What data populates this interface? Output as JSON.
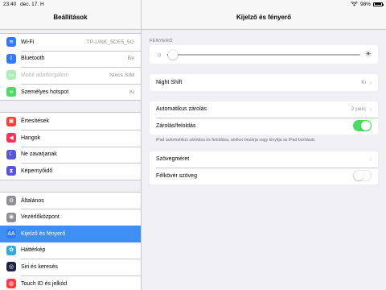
{
  "status_bar": {
    "time": "23:40",
    "date": "dec. 17. H",
    "battery": "98%",
    "battery_level": 0.98
  },
  "sidebar": {
    "title": "Beállítások",
    "groups": [
      [
        {
          "label": "Wi-Fi",
          "value": "TP-LINK_5CE5_5G",
          "icon": "wifi-icon",
          "color": "#3478f6",
          "glyph": "≋"
        },
        {
          "label": "Bluetooth",
          "value": "Be",
          "icon": "bluetooth-icon",
          "color": "#3478f6",
          "glyph": "ᛒ"
        },
        {
          "label": "Mobil adatforgalom",
          "value": "Nincs SIM",
          "icon": "cellular-icon",
          "color": "#4cd964",
          "glyph": "((•))",
          "dim": true
        },
        {
          "label": "Személyes hotspot",
          "value": "Ki",
          "icon": "hotspot-icon",
          "color": "#4cd964",
          "glyph": "∞"
        }
      ],
      [
        {
          "label": "Értesítések",
          "value": "",
          "icon": "notifications-icon",
          "color": "#fc3d39",
          "glyph": "▣"
        },
        {
          "label": "Hangok",
          "value": "",
          "icon": "sounds-icon",
          "color": "#fc3158",
          "glyph": "◀"
        },
        {
          "label": "Ne zavarjanak",
          "value": "",
          "icon": "do-not-disturb-icon",
          "color": "#5856d6",
          "glyph": "☾"
        },
        {
          "label": "Képernyőidő",
          "value": "",
          "icon": "screen-time-icon",
          "color": "#5856d6",
          "glyph": "⧗"
        }
      ],
      [
        {
          "label": "Általános",
          "value": "",
          "icon": "general-icon",
          "color": "#8e8e93",
          "glyph": "⚙"
        },
        {
          "label": "Vezérlőközpont",
          "value": "",
          "icon": "control-center-icon",
          "color": "#8e8e93",
          "glyph": "◉"
        },
        {
          "label": "Kijelző és fényerő",
          "value": "",
          "icon": "display-brightness-icon",
          "color": "#3478f6",
          "glyph": "AA",
          "selected": true
        },
        {
          "label": "Háttérkép",
          "value": "",
          "icon": "wallpaper-icon",
          "color": "#34aadc",
          "glyph": "✿"
        },
        {
          "label": "Siri és keresés",
          "value": "",
          "icon": "siri-icon",
          "color": "#222244",
          "glyph": "◎"
        },
        {
          "label": "Touch ID és jelkód",
          "value": "",
          "icon": "touch-id-icon",
          "color": "#fc3d39",
          "glyph": "◍"
        }
      ]
    ]
  },
  "detail": {
    "title": "Kijelző és fényerő",
    "brightness_section_title": "FÉNYERŐ",
    "brightness_level": 0.03,
    "night_shift": {
      "label": "Night Shift",
      "value": "Ki"
    },
    "auto_lock": {
      "label": "Automatikus zárolás",
      "value": "2 perc"
    },
    "lock_unlock": {
      "label": "Zárolás/feloldás",
      "on": true
    },
    "lock_footnote": "iPad automatikus zárolása és feloldása, amikor bezárja vagy kinyitja az iPad borítását.",
    "text_size": {
      "label": "Szövegméret"
    },
    "bold_text": {
      "label": "Félkövér szöveg",
      "on": false
    }
  }
}
